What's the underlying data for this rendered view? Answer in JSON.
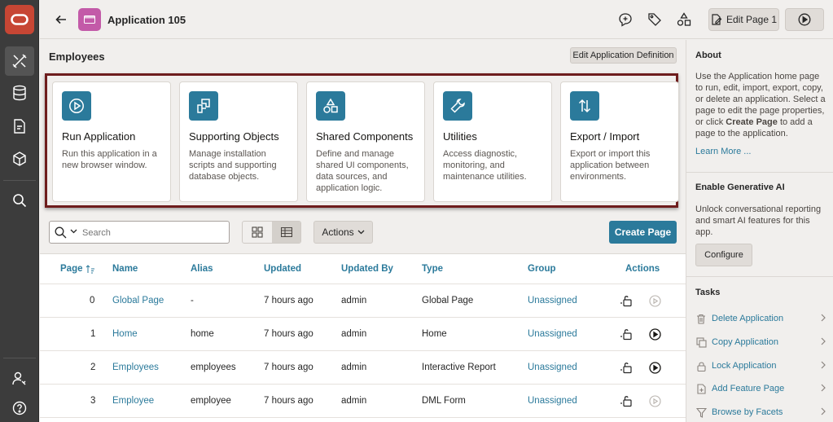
{
  "header": {
    "app_title": "Application 105",
    "edit_page_label": "Edit Page 1"
  },
  "main": {
    "page_heading": "Employees",
    "edit_app_def_label": "Edit Application Definition",
    "cards": [
      {
        "title": "Run Application",
        "desc": "Run this application in a new browser window.",
        "icon": "play-circle-icon"
      },
      {
        "title": "Supporting Objects",
        "desc": "Manage installation scripts and supporting database objects.",
        "icon": "supporting-objects-icon"
      },
      {
        "title": "Shared Components",
        "desc": "Define and manage shared UI components, data sources, and application logic.",
        "icon": "shapes-icon"
      },
      {
        "title": "Utilities",
        "desc": "Access diagnostic, monitoring, and maintenance utilities.",
        "icon": "wrench-icon"
      },
      {
        "title": "Export / Import",
        "desc": "Export or import this application between environments.",
        "icon": "export-import-icon"
      }
    ],
    "search_placeholder": "Search",
    "actions_label": "Actions",
    "create_page_label": "Create Page"
  },
  "table": {
    "headers": {
      "page": "Page",
      "name": "Name",
      "alias": "Alias",
      "updated": "Updated",
      "updated_by": "Updated By",
      "type": "Type",
      "group": "Group",
      "actions": "Actions"
    },
    "rows": [
      {
        "page": "0",
        "name": "Global Page",
        "alias": "-",
        "updated": "7 hours ago",
        "updated_by": "admin",
        "type": "Global Page",
        "group": "Unassigned",
        "run_enabled": false
      },
      {
        "page": "1",
        "name": "Home",
        "alias": "home",
        "updated": "7 hours ago",
        "updated_by": "admin",
        "type": "Home",
        "group": "Unassigned",
        "run_enabled": true
      },
      {
        "page": "2",
        "name": "Employees",
        "alias": "employees",
        "updated": "7 hours ago",
        "updated_by": "admin",
        "type": "Interactive Report",
        "group": "Unassigned",
        "run_enabled": true
      },
      {
        "page": "3",
        "name": "Employee",
        "alias": "employee",
        "updated": "7 hours ago",
        "updated_by": "admin",
        "type": "DML Form",
        "group": "Unassigned",
        "run_enabled": false
      }
    ]
  },
  "right_panel": {
    "about_title": "About",
    "about_text_1": "Use the Application home page to run, edit, import, export, copy, or delete an application. Select a page to edit the page properties, or click",
    "about_bold": "Create Page",
    "about_text_2": "to add a page to the application.",
    "learn_more": "Learn More ...",
    "genai_title": "Enable Generative AI",
    "genai_text": "Unlock conversational reporting and smart AI features for this app.",
    "configure_label": "Configure",
    "tasks_title": "Tasks",
    "tasks": [
      {
        "label": "Delete Application",
        "icon": "trash-icon"
      },
      {
        "label": "Copy Application",
        "icon": "copy-icon"
      },
      {
        "label": "Lock Application",
        "icon": "lock-icon"
      },
      {
        "label": "Add Feature Page",
        "icon": "add-page-icon"
      },
      {
        "label": "Browse by Facets",
        "icon": "filter-icon"
      }
    ]
  },
  "colors": {
    "accent": "#2b7a9b",
    "rail": "#3c3c3c",
    "brand": "#c74634",
    "app_icon": "#c35aa8",
    "highlight_frame": "#6e1d1d"
  }
}
